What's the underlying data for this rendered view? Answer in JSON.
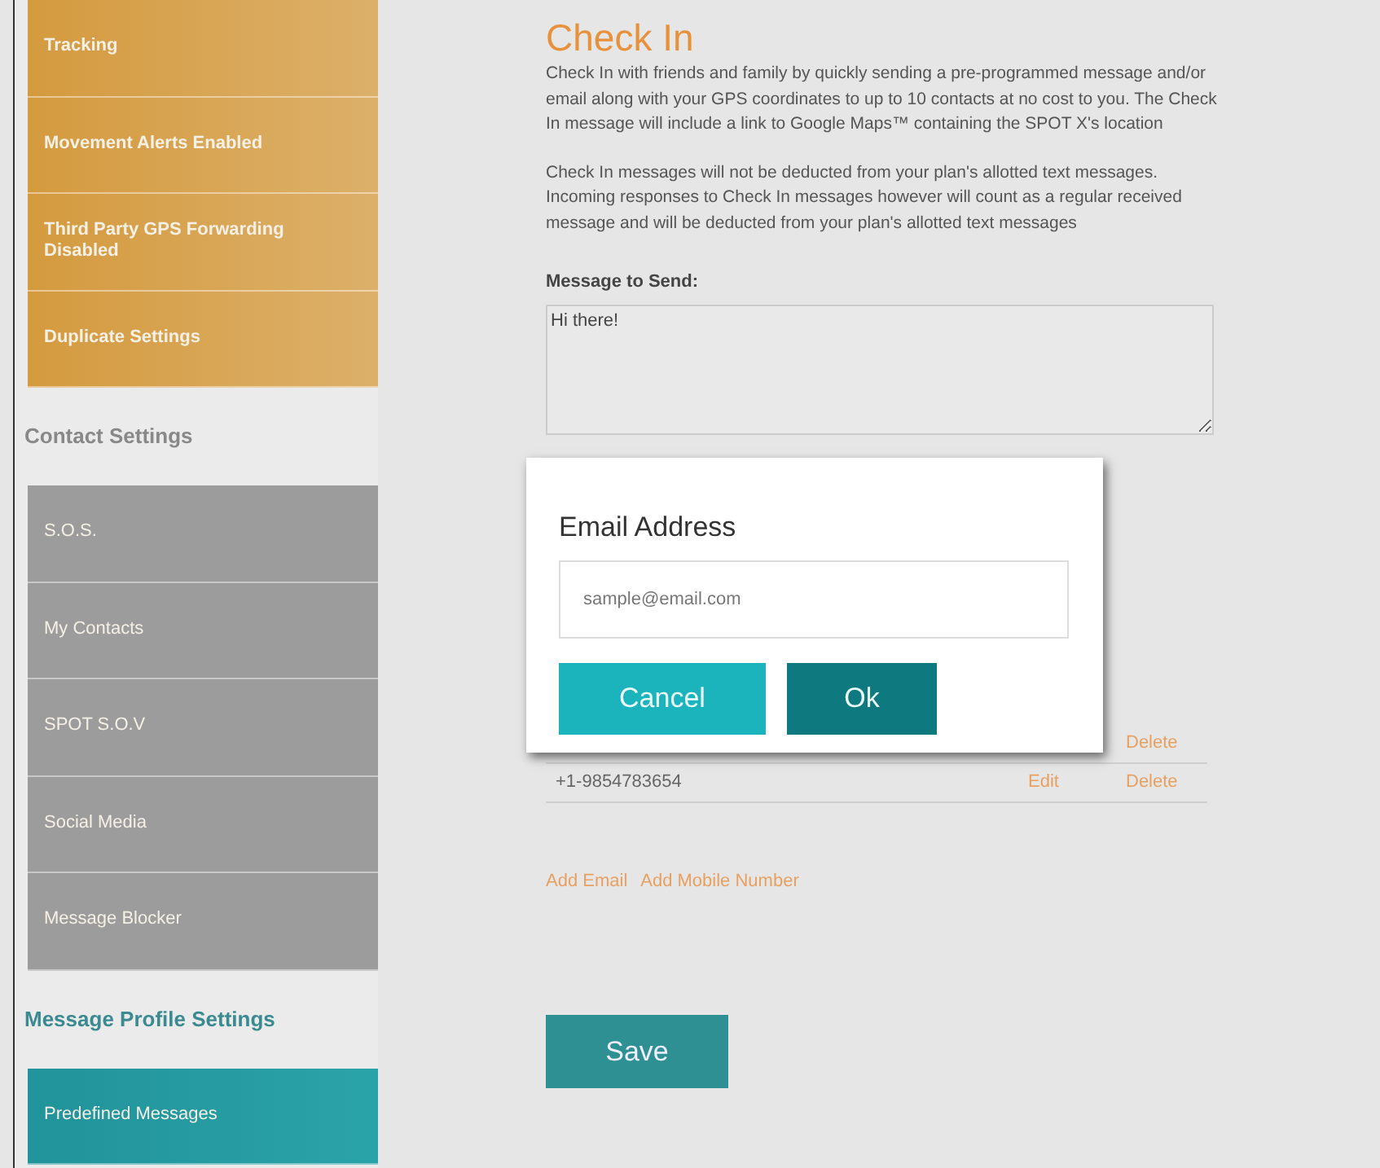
{
  "sidebar": {
    "sections": [
      {
        "kind": "device",
        "items": [
          {
            "label": "Tracking"
          },
          {
            "label": "Movement Alerts Enabled"
          },
          {
            "label": "Third Party GPS Forwarding Disabled"
          },
          {
            "label": "Duplicate Settings"
          }
        ]
      },
      {
        "heading": "Contact Settings",
        "kind": "contact",
        "items": [
          {
            "label": "S.O.S."
          },
          {
            "label": "My Contacts"
          },
          {
            "label": "SPOT S.O.V"
          },
          {
            "label": "Social Media"
          },
          {
            "label": "Message Blocker"
          }
        ]
      },
      {
        "heading": "Message Profile Settings",
        "kind": "profile",
        "items": [
          {
            "label": "Predefined Messages"
          }
        ]
      }
    ]
  },
  "main": {
    "title": "Check In",
    "paragraphs": [
      "Check In with friends and family by quickly sending a pre-programmed message and/or email along with your GPS coordinates to up to 10 contacts at no cost to you. The Check In message will include a link to Google Maps™ containing the SPOT X's location",
      "Check In messages will not be deducted from your plan's allotted text messages. Incoming responses to Check In messages however will count as a regular received message and will be deducted from your plan's allotted text messages"
    ],
    "message_label": "Message to Send:",
    "message_value": "Hi there!",
    "contacts": [
      {
        "delete": "Delete"
      },
      {
        "contact": "+1-9854783654",
        "edit": "Edit",
        "delete": "Delete"
      }
    ],
    "links": [
      "Add Email",
      "Add Mobile Number"
    ],
    "save": "Save"
  },
  "dialog": {
    "title": "Email Address",
    "placeholder": "sample@email.com",
    "buttons": [
      {
        "label": "Cancel",
        "kind": "secondary"
      },
      {
        "label": "Ok",
        "kind": "primary"
      }
    ]
  }
}
